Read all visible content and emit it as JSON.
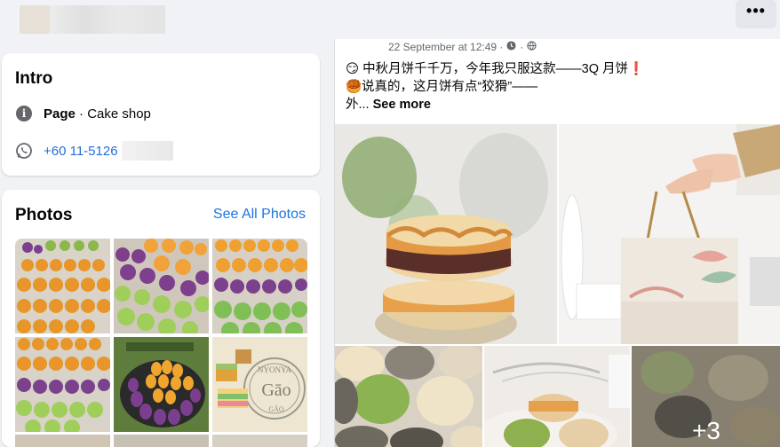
{
  "header": {
    "more_label": "•••"
  },
  "intro": {
    "title": "Intro",
    "category_prefix": "Page",
    "category_suffix": " · Cake shop",
    "phone": "+60 11-5126"
  },
  "photos": {
    "title": "Photos",
    "see_all": "See All Photos",
    "thumb4_text1": "NYONYA",
    "thumb4_text2": "Gāo",
    "thumb4_text3": "GĀO"
  },
  "post": {
    "timestamp": "22 September at 12:49 ·",
    "line1": "😏 中秋月饼千千万，今年我只服这款——3Q 月饼❗",
    "line2": "🥮说真的，这月饼有点“狡猾”——",
    "line3_prefix": "外...",
    "see_more": " See more",
    "extra_count": "+3"
  },
  "colors": {
    "accent": "#1b74e4",
    "bg": "#f0f2f5"
  }
}
